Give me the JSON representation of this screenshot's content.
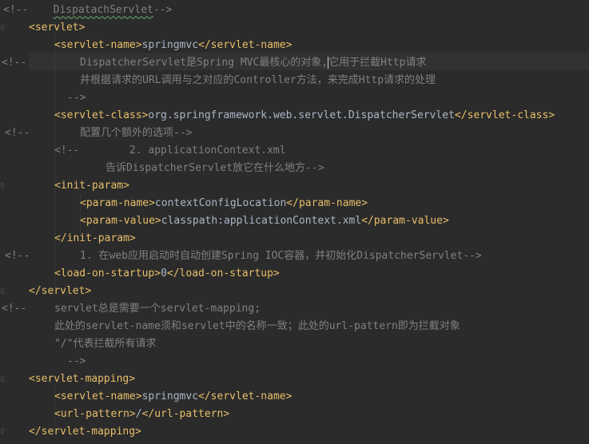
{
  "editor": {
    "lines": [
      {
        "id": "l1",
        "parts": [
          {
            "c": "cmt",
            "t": "<!--    "
          },
          {
            "c": "cmt squig",
            "t": "DispatachServlet"
          },
          {
            "c": "cmt",
            "t": "-->"
          }
        ]
      },
      {
        "id": "l2",
        "parts": [
          {
            "c": "tag",
            "t": "<servlet>"
          }
        ]
      },
      {
        "id": "l3",
        "parts": [
          {
            "c": "tag",
            "t": "<servlet-name>"
          },
          {
            "c": "txt",
            "t": "springmvc"
          },
          {
            "c": "tag",
            "t": "</servlet-name>"
          }
        ]
      },
      {
        "id": "l4",
        "parts": [
          {
            "c": "cmt",
            "t": "DispatcherServlet是Spring MVC最核心的对象,"
          },
          {
            "c": "caret",
            "t": ""
          },
          {
            "c": "cmt",
            "t": "它用于拦截Http请求"
          }
        ]
      },
      {
        "id": "l5",
        "parts": [
          {
            "c": "cmt",
            "t": "并根据请求的URL调用与之对应的Controller方法，来完成Http请求的处理"
          }
        ]
      },
      {
        "id": "l6",
        "parts": [
          {
            "c": "cmt",
            "t": "-->"
          }
        ]
      },
      {
        "id": "l7",
        "parts": [
          {
            "c": "tag",
            "t": "<servlet-class>"
          },
          {
            "c": "txt",
            "t": "org.springframework.web.servlet.DispatcherServlet"
          },
          {
            "c": "tag",
            "t": "</servlet-class>"
          }
        ]
      },
      {
        "id": "l8",
        "parts": [
          {
            "c": "cmt",
            "t": "配置几个额外的选项-->"
          }
        ]
      },
      {
        "id": "l9",
        "parts": [
          {
            "c": "cmt",
            "t": "<!--        2. applicationContext.xml"
          }
        ]
      },
      {
        "id": "l10",
        "parts": [
          {
            "c": "cmt",
            "t": "告诉DispatcherServlet放它在什么地方-->"
          }
        ]
      },
      {
        "id": "l11",
        "parts": [
          {
            "c": "tag",
            "t": "<init-param>"
          }
        ]
      },
      {
        "id": "l12",
        "parts": [
          {
            "c": "tag",
            "t": "<param-name>"
          },
          {
            "c": "txt",
            "t": "contextConfigLocation"
          },
          {
            "c": "tag",
            "t": "</param-name>"
          }
        ]
      },
      {
        "id": "l13",
        "parts": [
          {
            "c": "tag",
            "t": "<param-value>"
          },
          {
            "c": "txt",
            "t": "classpath:applicationContext.xml"
          },
          {
            "c": "tag",
            "t": "</param-value>"
          }
        ]
      },
      {
        "id": "l14",
        "parts": [
          {
            "c": "tag",
            "t": "</init-param>"
          }
        ]
      },
      {
        "id": "l15",
        "parts": [
          {
            "c": "cmt",
            "t": "1. 在web应用启动时自动创建Spring IOC容器，并初始化DispatcherServlet-->"
          }
        ]
      },
      {
        "id": "l16",
        "parts": [
          {
            "c": "tag",
            "t": "<load-on-startup>"
          },
          {
            "c": "txt",
            "t": "0"
          },
          {
            "c": "tag",
            "t": "</load-on-startup>"
          }
        ]
      },
      {
        "id": "l17",
        "parts": [
          {
            "c": "tag",
            "t": "</servlet>"
          }
        ]
      },
      {
        "id": "l18",
        "parts": [
          {
            "c": "cmt",
            "t": "servlet总是需要一个servlet-mapping;"
          }
        ]
      },
      {
        "id": "l19",
        "parts": [
          {
            "c": "cmt",
            "t": "此处的servlet-name须和servlet中的名称一致；此处的url-pattern即为拦截对象"
          }
        ]
      },
      {
        "id": "l20",
        "parts": [
          {
            "c": "cmt",
            "t": "\"/\"代表拦截所有请求"
          }
        ]
      },
      {
        "id": "l21",
        "parts": [
          {
            "c": "cmt",
            "t": "-->"
          }
        ]
      },
      {
        "id": "l22",
        "parts": [
          {
            "c": "tag",
            "t": "<servlet-mapping>"
          }
        ]
      },
      {
        "id": "l23",
        "parts": [
          {
            "c": "tag",
            "t": "<servlet-name>"
          },
          {
            "c": "txt",
            "t": "springmvc"
          },
          {
            "c": "tag",
            "t": "</servlet-name>"
          }
        ]
      },
      {
        "id": "l24",
        "parts": [
          {
            "c": "tag",
            "t": "<url-pattern>"
          },
          {
            "c": "txt",
            "t": "/"
          },
          {
            "c": "tag",
            "t": "</url-pattern>"
          }
        ]
      },
      {
        "id": "l25",
        "parts": [
          {
            "c": "tag",
            "t": "</servlet-mapping>"
          }
        ]
      }
    ],
    "gutter_markers": {
      "l4": "<!--",
      "l8": "<!--",
      "l15": "<!--",
      "l18": "<!--"
    },
    "colors": {
      "background": "#2b2b2b",
      "comment": "#808080",
      "tag": "#e8bf6a",
      "text": "#a9b7c6"
    }
  }
}
